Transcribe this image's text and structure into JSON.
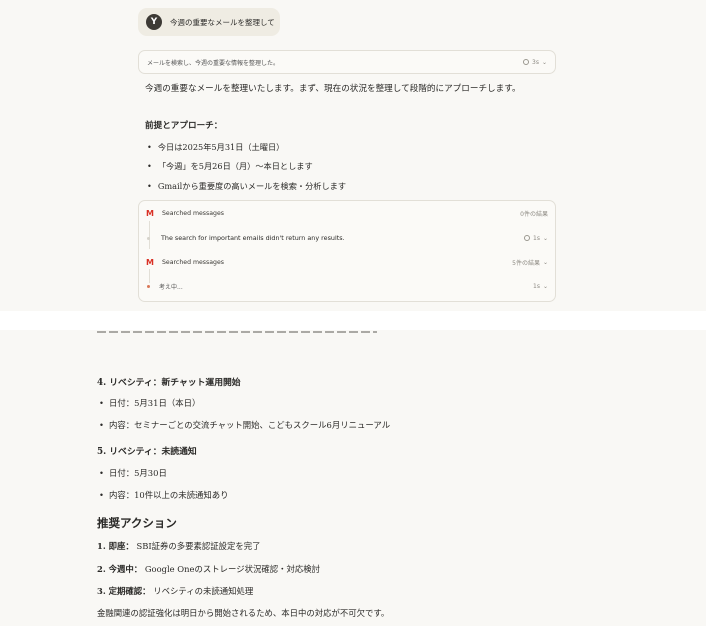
{
  "user_message": {
    "avatar": "Y",
    "text": "今週の重要なメールを整理して"
  },
  "thinking": {
    "text": "メールを検索し、今週の重要な情報を整理した。",
    "duration": "3s"
  },
  "intro": "今週の重要なメールを整理いたします。まず、現在の状況を整理して段階的にアプローチします。",
  "approach": {
    "heading": "前提とアプローチ：",
    "bullets": [
      "今日は2025年5月31日（土曜日）",
      "「今週」を5月26日（月）〜本日とします",
      "Gmailから重要度の高いメールを検索・分析します"
    ]
  },
  "tools": [
    {
      "title": "Searched messages",
      "meta": "0件の結果"
    },
    {
      "text": "The search for important emails didn't return any results.",
      "meta": "1s"
    },
    {
      "title": "Searched messages",
      "meta": "5件の結果"
    },
    {
      "text": "考え中...",
      "meta": "1s"
    }
  ],
  "items": [
    {
      "heading": "4. リベシティ：新チャット運用開始",
      "bullets": [
        "日付：5月31日（本日）",
        "内容：セミナーごとの交流チャット開始、こどもスクール6月リニューアル"
      ]
    },
    {
      "heading": "5. リベシティ：未読通知",
      "bullets": [
        "日付：5月30日",
        "内容：10件以上の未読通知あり"
      ]
    }
  ],
  "actions": {
    "heading": "推奨アクション",
    "list": [
      {
        "label": "1. 即座：",
        "text": " SBI証券の多要素認証設定を完了"
      },
      {
        "label": "2. 今週中：",
        "text": " Google Oneのストレージ状況確認・対応検討"
      },
      {
        "label": "3. 定期確認：",
        "text": " リベシティの未読通知処理"
      }
    ]
  },
  "footer": "金融関連の認証強化は明日から開始されるため、本日中の対応が不可欠です。"
}
